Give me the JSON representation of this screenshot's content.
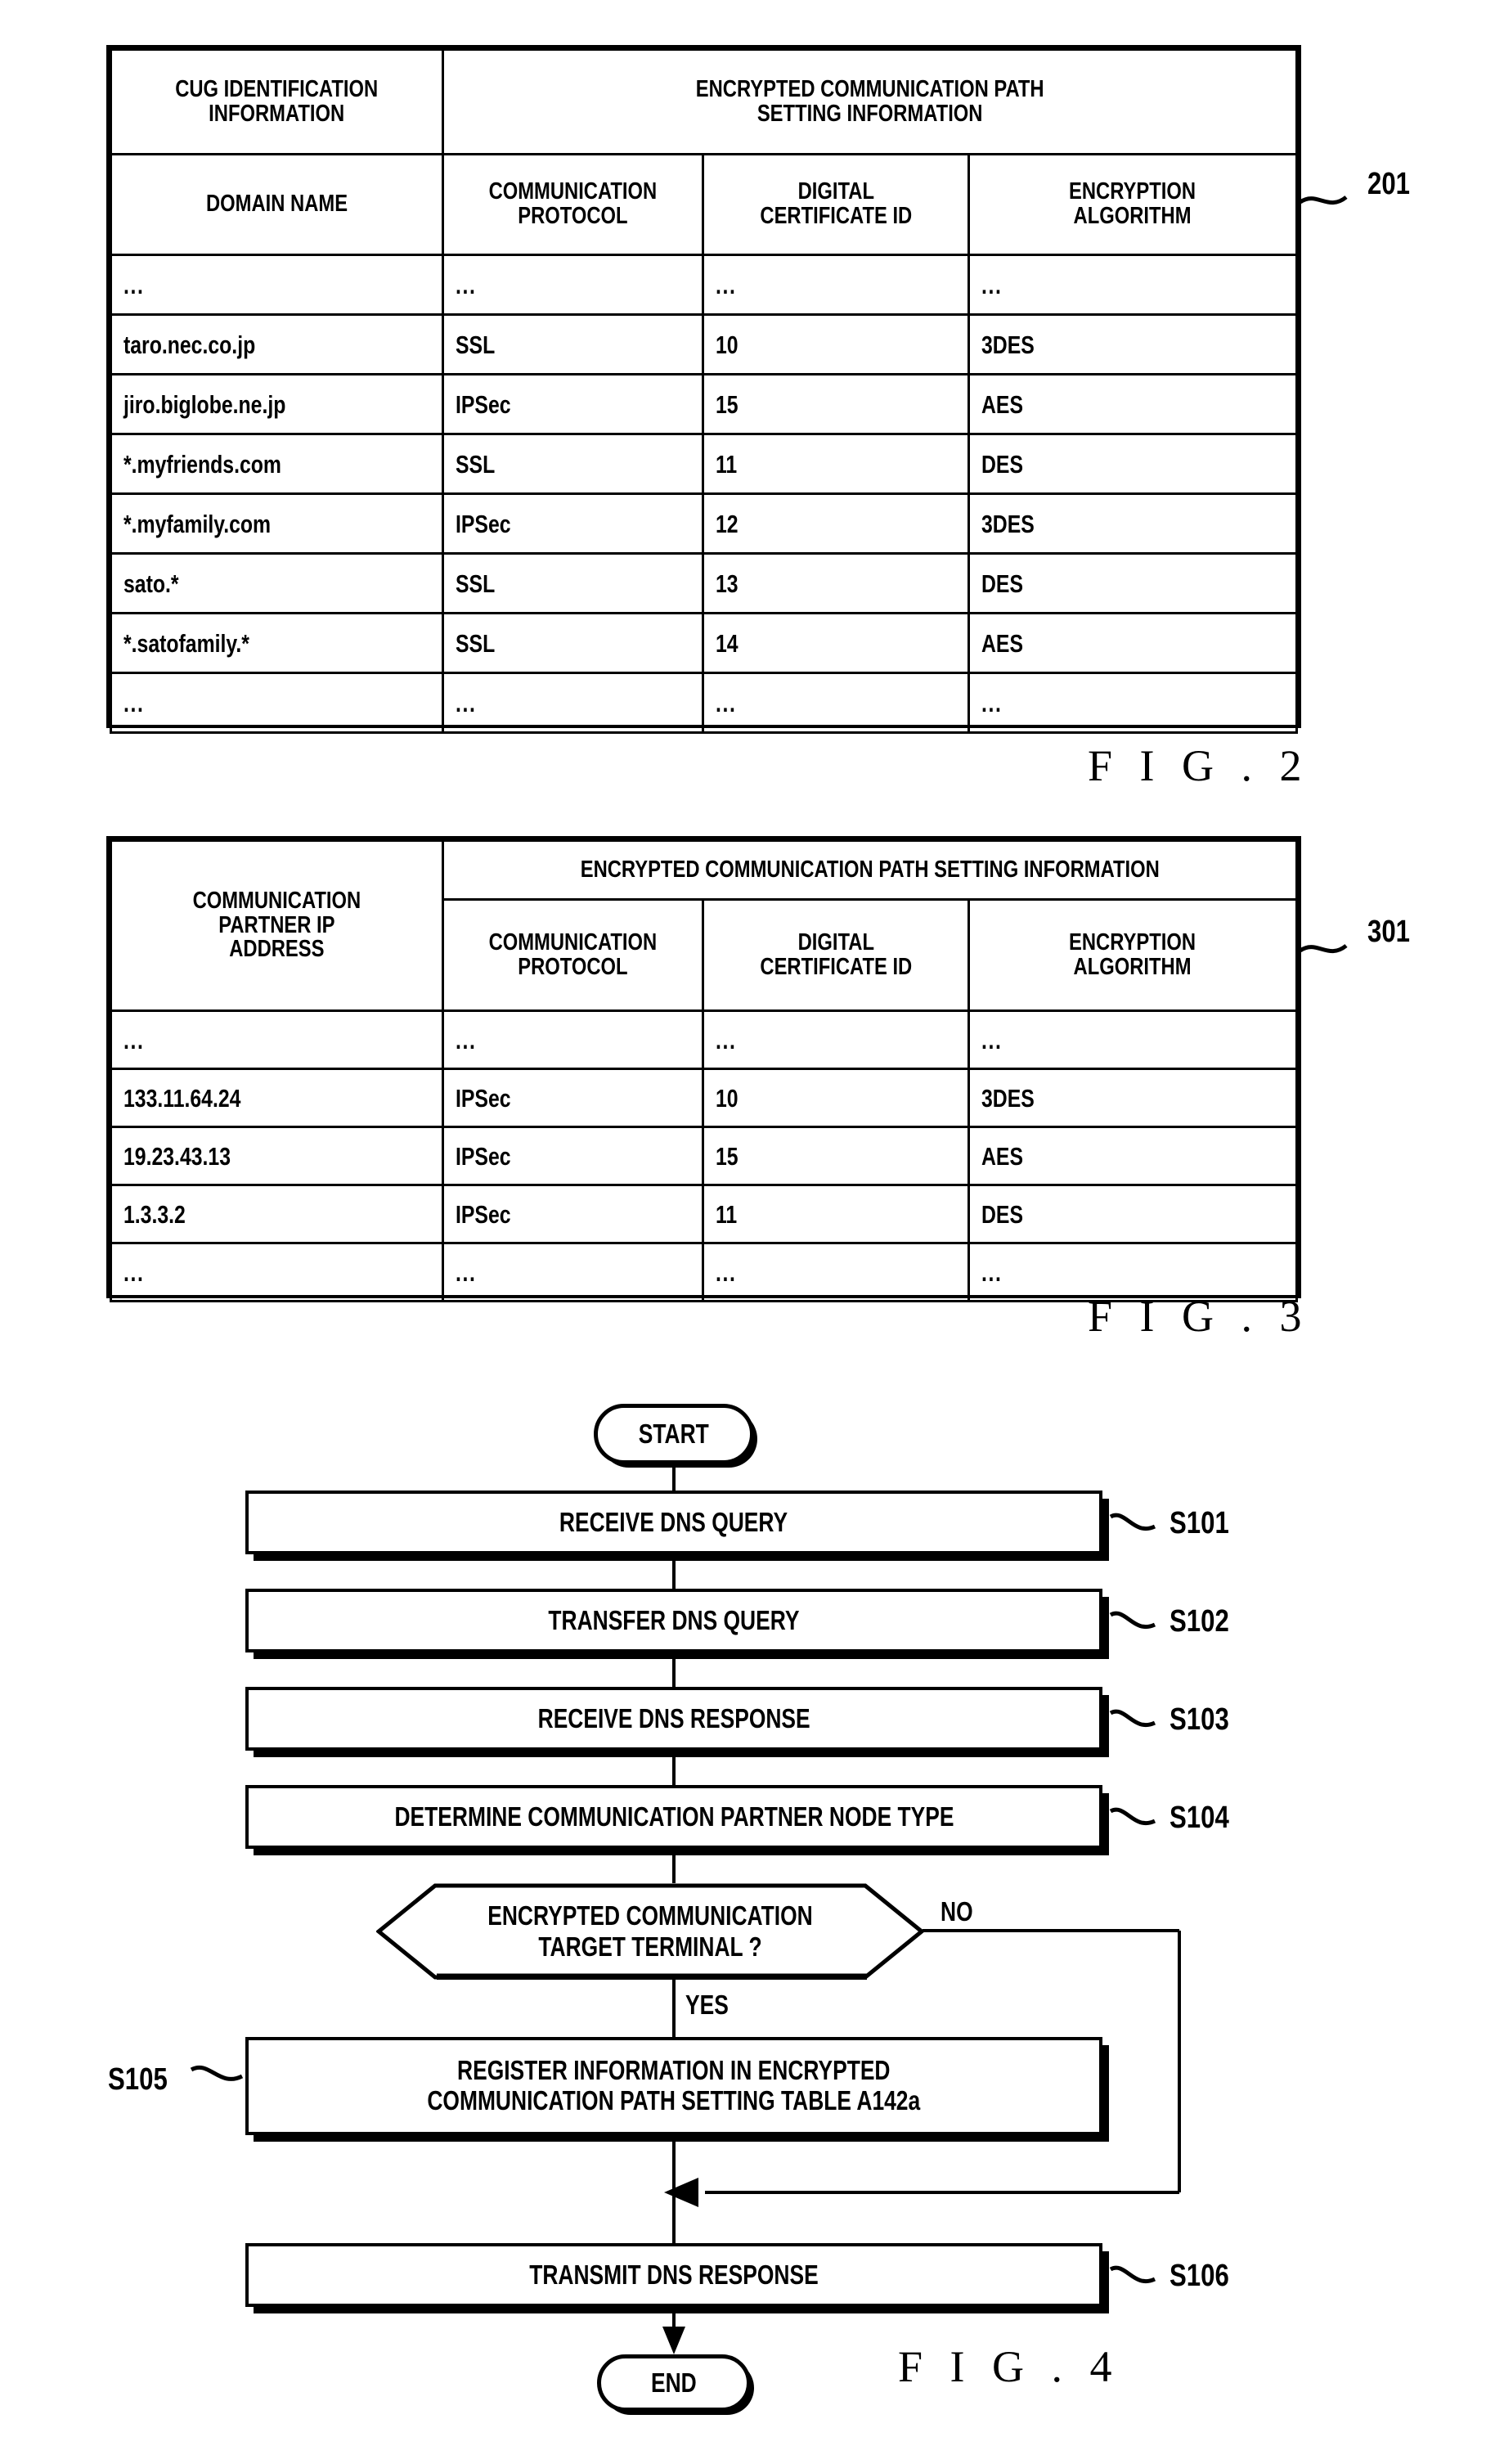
{
  "figures": [
    {
      "id": "fig2",
      "label": "F I G . 2",
      "ref_numeral": "201",
      "table": {
        "group_headers": [
          {
            "text": "CUG IDENTIFICATION\nINFORMATION",
            "span": 1
          },
          {
            "text": "ENCRYPTED COMMUNICATION PATH\nSETTING INFORMATION",
            "span": 3
          }
        ],
        "column_headers": [
          "DOMAIN NAME",
          "COMMUNICATION\nPROTOCOL",
          "DIGITAL\nCERTIFICATE ID",
          "ENCRYPTION\nALGORITHM"
        ],
        "rows": [
          [
            "...",
            "...",
            "...",
            "..."
          ],
          [
            "taro.nec.co.jp",
            "SSL",
            "10",
            "3DES"
          ],
          [
            "jiro.biglobe.ne.jp",
            "IPSec",
            "15",
            "AES"
          ],
          [
            "*.myfriends.com",
            "SSL",
            "11",
            "DES"
          ],
          [
            "*.myfamily.com",
            "IPSec",
            "12",
            "3DES"
          ],
          [
            "sato.*",
            "SSL",
            "13",
            "DES"
          ],
          [
            "*.satofamily.*",
            "SSL",
            "14",
            "AES"
          ],
          [
            "...",
            "...",
            "...",
            "..."
          ]
        ]
      }
    },
    {
      "id": "fig3",
      "label": "F I G . 3",
      "ref_numeral": "301",
      "table": {
        "row_header": "COMMUNICATION\nPARTNER IP\nADDRESS",
        "group_header": "ENCRYPTED COMMUNICATION PATH SETTING INFORMATION",
        "column_headers": [
          "COMMUNICATION\nPROTOCOL",
          "DIGITAL\nCERTIFICATE ID",
          "ENCRYPTION\nALGORITHM"
        ],
        "rows": [
          [
            "...",
            "...",
            "...",
            "..."
          ],
          [
            "133.11.64.24",
            "IPSec",
            "10",
            "3DES"
          ],
          [
            "19.23.43.13",
            "IPSec",
            "15",
            "AES"
          ],
          [
            "1.3.3.2",
            "IPSec",
            "11",
            "DES"
          ],
          [
            "...",
            "...",
            "...",
            "..."
          ]
        ]
      }
    },
    {
      "id": "fig4",
      "label": "F I G . 4",
      "flowchart": {
        "start_label": "START",
        "end_label": "END",
        "yes_label": "YES",
        "no_label": "NO",
        "steps": [
          {
            "tag": "S101",
            "text": "RECEIVE DNS QUERY"
          },
          {
            "tag": "S102",
            "text": "TRANSFER DNS QUERY"
          },
          {
            "tag": "S103",
            "text": "RECEIVE DNS RESPONSE"
          },
          {
            "tag": "S104",
            "text": "DETERMINE COMMUNICATION PARTNER NODE TYPE"
          }
        ],
        "decision": {
          "text": "ENCRYPTED COMMUNICATION\nTARGET TERMINAL ?"
        },
        "register_step": {
          "tag": "S105",
          "text": "REGISTER INFORMATION IN ENCRYPTED\nCOMMUNICATION PATH SETTING TABLE A142a"
        },
        "final_step": {
          "tag": "S106",
          "text": "TRANSMIT DNS RESPONSE"
        }
      }
    }
  ],
  "colors": {
    "ink": "#000000",
    "paper": "#ffffff"
  }
}
